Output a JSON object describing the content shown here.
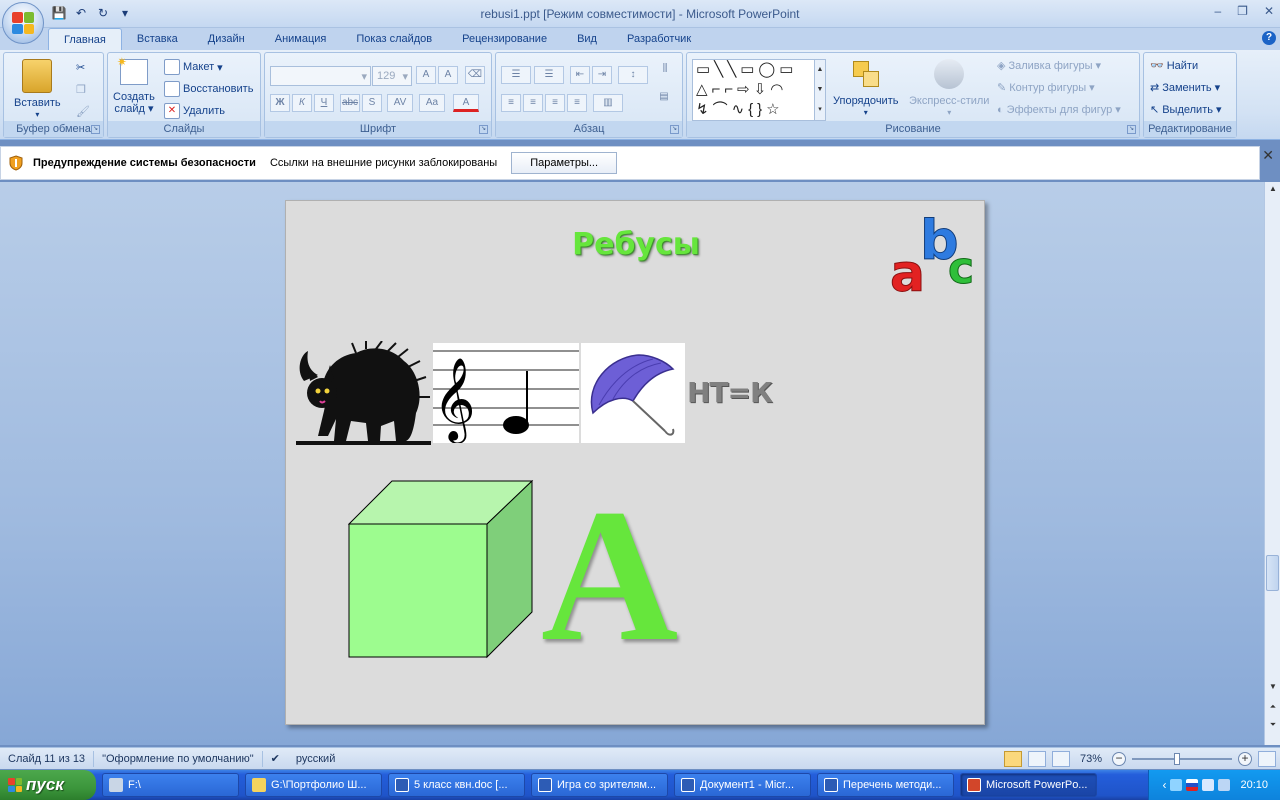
{
  "window": {
    "title": "rebusi1.ppt [Режим совместимости] - Microsoft PowerPoint",
    "controls": [
      "‒",
      "❐",
      "✕"
    ]
  },
  "qat": {
    "save": "💾",
    "undo": "↶",
    "redo": "↻",
    "more": "▾"
  },
  "tabs": [
    "Главная",
    "Вставка",
    "Дизайн",
    "Анимация",
    "Показ слайдов",
    "Рецензирование",
    "Вид",
    "Разработчик"
  ],
  "ribbon": {
    "clipboard": {
      "label": "Буфер обмена",
      "paste": "Вставить"
    },
    "slides": {
      "label": "Слайды",
      "create": "Создать",
      "create2": "слайд",
      "layout": "Макет",
      "restore": "Восстановить",
      "delete": "Удалить"
    },
    "font": {
      "label": "Шрифт",
      "size": "129",
      "buttons": [
        "Ж",
        "К",
        "Ч",
        "abc",
        "S",
        "AV",
        "Aa",
        "A"
      ]
    },
    "paragraph": {
      "label": "Абзац"
    },
    "drawing": {
      "label": "Рисование",
      "arrange": "Упорядочить",
      "quick_styles": "Экспресс-стили",
      "fill": "Заливка фигуры",
      "outline": "Контур фигуры",
      "effects": "Эффекты для фигур"
    },
    "editing": {
      "label": "Редактирование",
      "find": "Найти",
      "replace": "Заменить",
      "select": "Выделить"
    }
  },
  "security": {
    "title": "Предупреждение системы безопасности",
    "message": "Ссылки на внешние рисунки заблокированы",
    "button": "Параметры..."
  },
  "slide": {
    "title": "Ребусы",
    "rebus_text": "НТ=К",
    "letter": "A"
  },
  "statusbar": {
    "slide_info": "Слайд 11 из 13",
    "theme": "\"Оформление по умолчанию\"",
    "language": "русский",
    "zoom": "73%",
    "zoom_fraction": 0.42
  },
  "taskbar": {
    "start": "пуск",
    "tasks": [
      {
        "label": "F:\\",
        "active": false
      },
      {
        "label": "G:\\Портфолио Ш...",
        "active": false
      },
      {
        "label": "5 класс квн.doc [...",
        "active": false
      },
      {
        "label": "Игра со зрителям...",
        "active": false
      },
      {
        "label": "Документ1 - Micr...",
        "active": false
      },
      {
        "label": "Перечень методи...",
        "active": false
      },
      {
        "label": "Microsoft PowerPo...",
        "active": true
      }
    ],
    "clock": "20:10"
  }
}
